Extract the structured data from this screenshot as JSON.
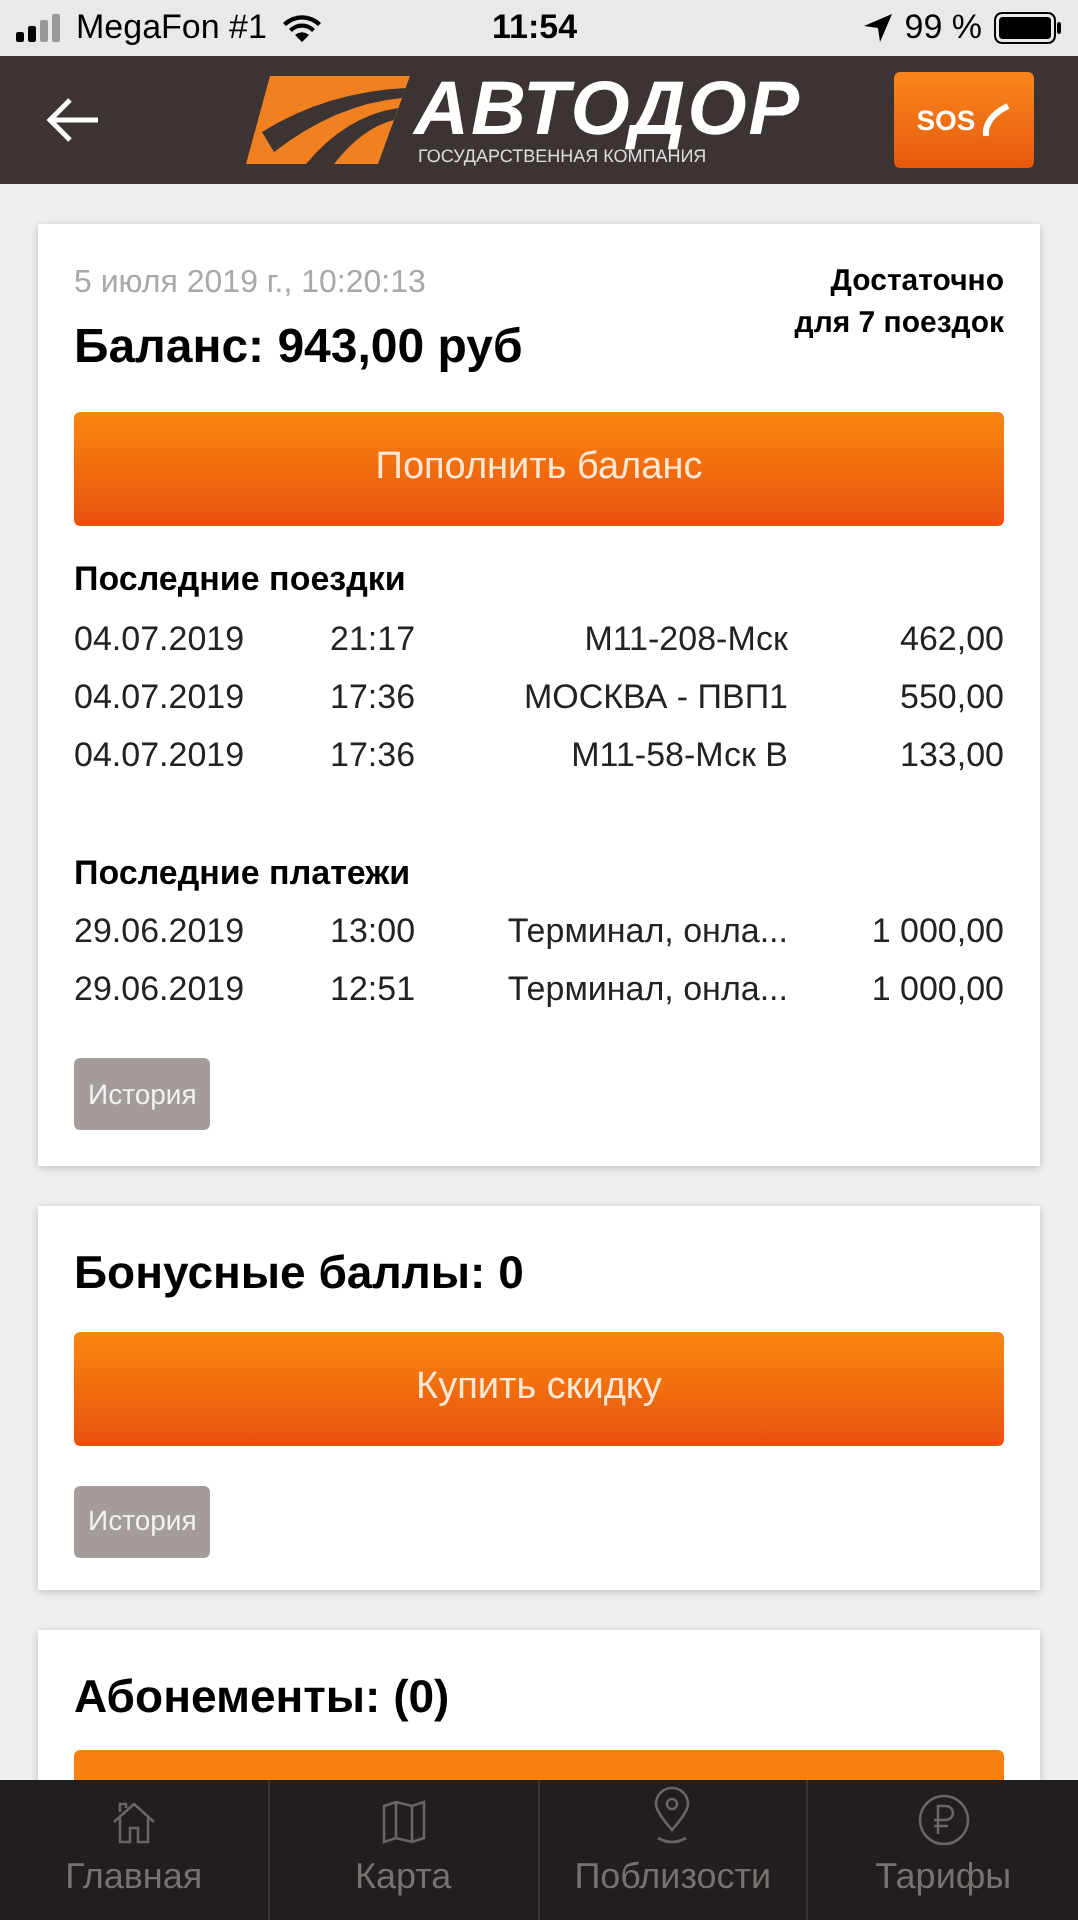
{
  "status_bar": {
    "carrier": "MegaFon #1",
    "time": "11:54",
    "battery": "99 %"
  },
  "header": {
    "logo_title": "АВТОДОР",
    "logo_subtitle": "ГОСУДАРСТВЕННАЯ КОМПАНИЯ",
    "sos": "SOS"
  },
  "balance_card": {
    "timestamp": "5 июля 2019 г., 10:20:13",
    "balance": "Баланс: 943,00 руб",
    "enough": "Достаточно для 7 поездок",
    "button": "Пополнить баланс",
    "sections": [
      {
        "title": "Последние поездки",
        "rows": [
          [
            "04.07.2019",
            "21:17",
            "М11-208-Мск",
            "462,00"
          ],
          [
            "04.07.2019",
            "17:36",
            "МОСКВА - ПВП1",
            "550,00"
          ],
          [
            "04.07.2019",
            "17:36",
            "М11-58-Мск В",
            "133,00"
          ]
        ]
      },
      {
        "title": "Последние платежи",
        "rows": [
          [
            "29.06.2019",
            "13:00",
            "Терминал, онла...",
            "1 000,00"
          ],
          [
            "29.06.2019",
            "12:51",
            "Терминал, онла...",
            "1 000,00"
          ]
        ]
      }
    ],
    "history": "История"
  },
  "bonus_card": {
    "title": "Бонусные баллы: 0",
    "button": "Купить скидку",
    "history": "История"
  },
  "subscriptions_card": {
    "title": "Абонементы: (0)"
  },
  "tab_bar": [
    {
      "kind": "home",
      "label": "Главная"
    },
    {
      "kind": "map",
      "label": "Карта"
    },
    {
      "kind": "pin",
      "label": "Поблизости"
    },
    {
      "kind": "ruble",
      "label": "Тарифы"
    }
  ]
}
